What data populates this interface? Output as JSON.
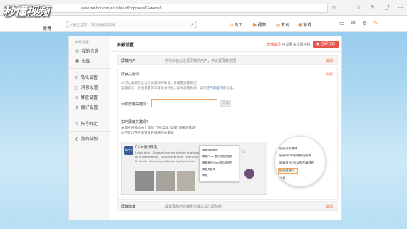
{
  "browser": {
    "url": "www.weibo.com/set/shield?topnav=1&wvr=6",
    "star_icon": "star-icon",
    "menu_icon": "menu-icon"
  },
  "brand": {
    "watermark": "秒懂视频",
    "sub": "微博"
  },
  "topnav": {
    "search_placeholder": "大家正在搜：中国网络联排韩",
    "links": [
      "首页",
      "视频",
      "发现",
      "游戏"
    ]
  },
  "sidebar": {
    "header": "帐号设置",
    "items": [
      {
        "label": "我的信息",
        "icon": "user-icon"
      },
      {
        "label": "头像",
        "icon": "face-icon"
      },
      {
        "label": "隐私设置",
        "icon": "lock-icon"
      },
      {
        "label": "消息设置",
        "icon": "message-icon"
      },
      {
        "label": "屏蔽设置",
        "icon": "block-icon"
      },
      {
        "label": "偏好设置",
        "icon": "gear-icon"
      },
      {
        "label": "帐号绑定",
        "icon": "link-icon"
      },
      {
        "label": "我的装扮",
        "icon": "skin-icon"
      }
    ]
  },
  "header": {
    "title": "屏蔽设置",
    "note_red": "微博会员",
    "note": "可享更多设置特权",
    "button": "立即开通"
  },
  "sections": {
    "block_users": {
      "title": "屏蔽用户",
      "desc": "你可以在此设置屏蔽的用户，并设置屏蔽范围",
      "action": "编辑"
    },
    "keywords": {
      "title": "屏蔽关键词",
      "fold": "收起",
      "desc1": "你可以屏蔽包含以下关键词的微博，并设置屏蔽范围",
      "desc2_pre": "温馨提示：会员设置可享受更多特权，如果屏蔽微博，请可使用",
      "desc2_link": "屏蔽作者",
      "desc2_post": "功能。",
      "input_label": "添加屏蔽关键词：",
      "input_button": "添加",
      "how_title": "如何屏蔽关键词？",
      "how_desc1": "右键点击微博右上角的“下拉菜单”选择“屏蔽关键词”",
      "how_desc2": "你还可以在这里管理已屏蔽的关键词"
    },
    "block_comments": {
      "title": "屏蔽微博",
      "desc": "设置屏蔽的微博类型或以及已屏蔽的",
      "action": "编辑"
    }
  },
  "example_shot": {
    "avatar": "flickr",
    "name": "Flickr图片精选",
    "lines": [
      "Lubrication - Grease from the bottom of a teapot",
      "of Improvements - Screenshot from Flickr user Dissolved",
      "Evolution Workshops, Wandering View Mesh"
    ],
    "menu": [
      "屏蔽该条微博",
      "屏蔽Flickr图片精选的微博",
      "屏蔽来自Flickr图片精选的",
      "屏蔽关键词",
      "举报"
    ]
  },
  "zoom": {
    "items": [
      "屏蔽该条微博",
      "屏蔽Flickr图片精选的微",
      "屏蔽来自Flickr图片精选的",
      "屏蔽关键词",
      "举报"
    ]
  }
}
